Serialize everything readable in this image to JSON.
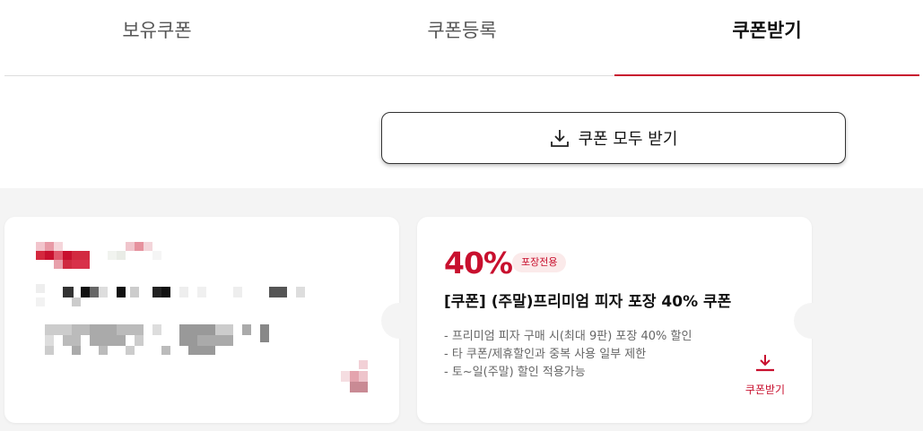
{
  "tabs": [
    {
      "label": "보유쿠폰"
    },
    {
      "label": "쿠폰등록"
    },
    {
      "label": "쿠폰받기"
    }
  ],
  "download_all": {
    "label": "쿠폰 모두 받기",
    "icon": "download-icon"
  },
  "coupon": {
    "discount": "40%",
    "badge": "포장전용",
    "title": "[쿠폰] (주말)프리미엄 피자 포장 40% 쿠폰",
    "details": [
      "- 프리미엄 피자 구매 시(최대 9판) 포장 40% 할인",
      "- 타 쿠폰/제휴할인과 중복 사용 일부 제한",
      "- 토~일(주말) 할인 적용가능"
    ],
    "download_label": "쿠폰받기",
    "download_icon": "download-icon"
  },
  "colors": {
    "accent": "#c8102e",
    "text": "#111111",
    "muted": "#666666"
  }
}
